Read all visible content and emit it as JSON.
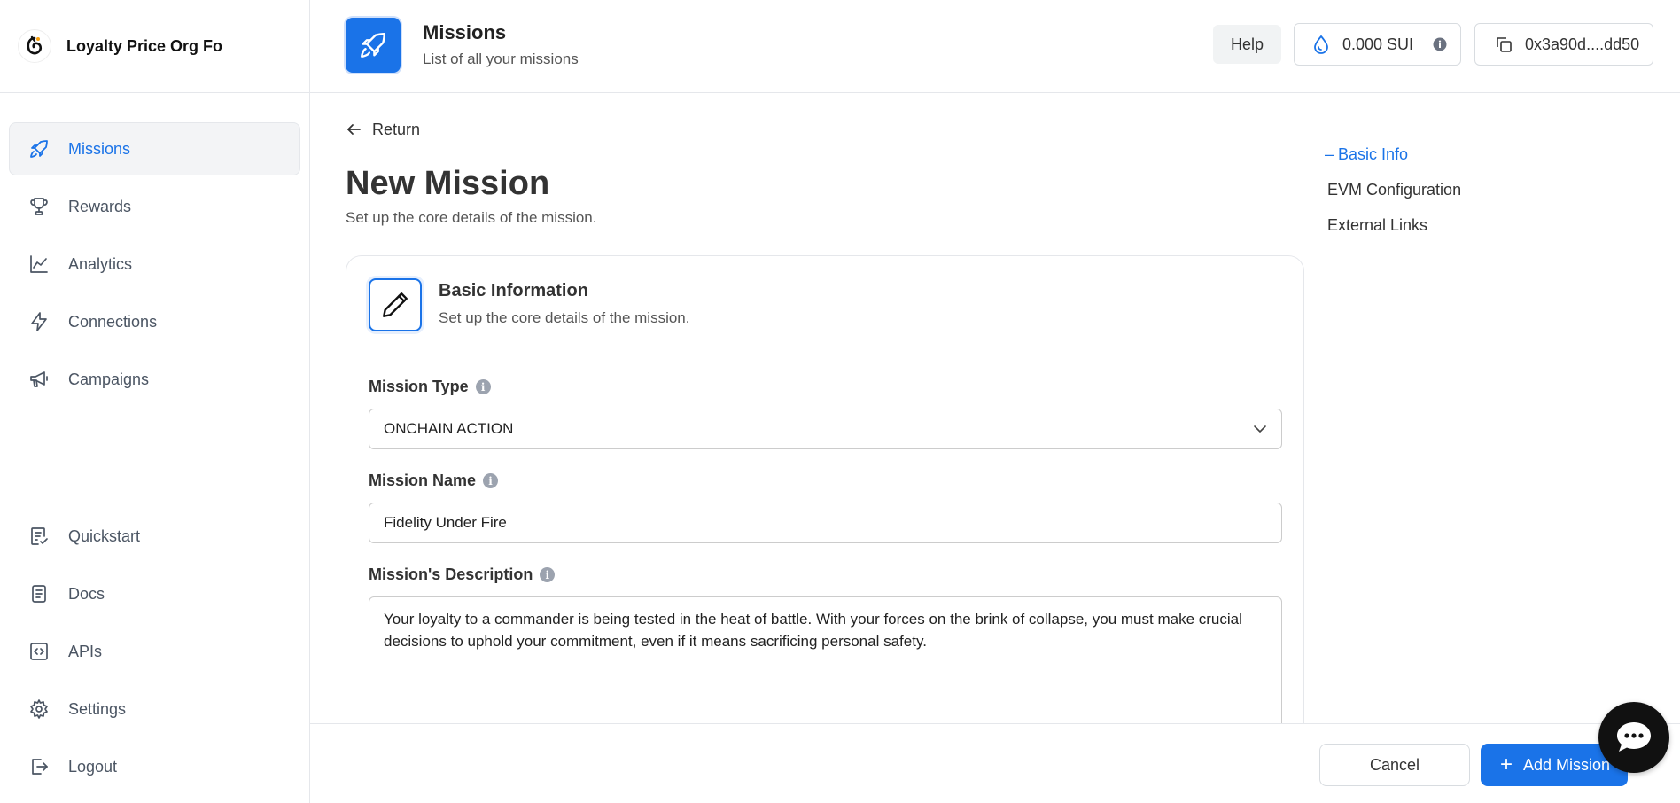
{
  "brand": {
    "name": "Loyalty Price Org Fo"
  },
  "sidebar": {
    "items": [
      {
        "label": "Missions",
        "icon": "rocket-icon",
        "active": true
      },
      {
        "label": "Rewards",
        "icon": "trophy-icon"
      },
      {
        "label": "Analytics",
        "icon": "line-chart-icon"
      },
      {
        "label": "Connections",
        "icon": "lightning-icon"
      },
      {
        "label": "Campaigns",
        "icon": "megaphone-icon"
      }
    ],
    "bottom_items": [
      {
        "label": "Quickstart",
        "icon": "checklist-icon"
      },
      {
        "label": "Docs",
        "icon": "document-icon"
      },
      {
        "label": "APIs",
        "icon": "code-icon"
      },
      {
        "label": "Settings",
        "icon": "gear-icon"
      },
      {
        "label": "Logout",
        "icon": "logout-icon"
      }
    ]
  },
  "header": {
    "title": "Missions",
    "subtitle": "List of all your missions",
    "help_label": "Help",
    "balance": "0.000 SUI",
    "wallet": "0x3a90d....dd50"
  },
  "main": {
    "return_label": "Return",
    "title": "New Mission",
    "subtitle": "Set up the core details of the mission."
  },
  "card": {
    "title": "Basic Information",
    "subtitle": "Set up the core details of the mission.",
    "mission_type_label": "Mission Type",
    "mission_type_value": "ONCHAIN ACTION",
    "mission_name_label": "Mission Name",
    "mission_name_value": "Fidelity Under Fire",
    "description_label": "Mission's Description",
    "description_value": "Your loyalty to a commander is being tested in the heat of battle. With your forces on the brink of collapse, you must make crucial decisions to uphold your commitment, even if it means sacrificing personal safety."
  },
  "toc": {
    "items": [
      {
        "label": "– Basic Info",
        "active": true
      },
      {
        "label": "EVM Configuration"
      },
      {
        "label": "External Links"
      }
    ]
  },
  "footer": {
    "cancel_label": "Cancel",
    "add_label": "Add Mission"
  },
  "colors": {
    "accent": "#1a73e8"
  }
}
